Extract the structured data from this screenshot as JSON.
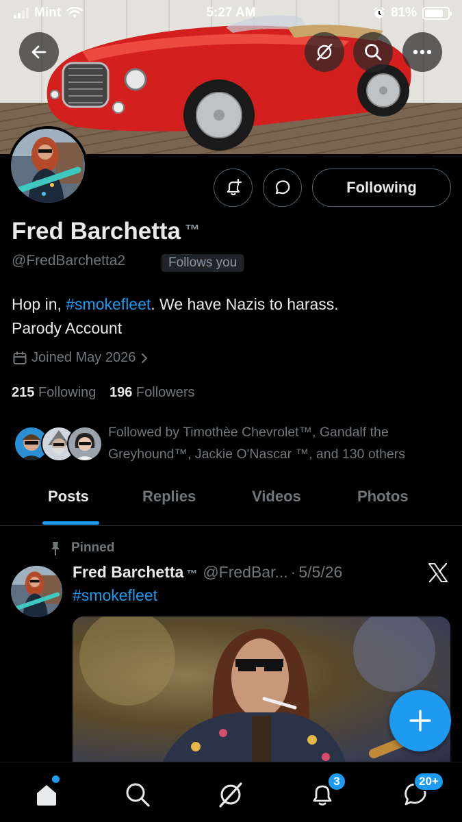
{
  "status_bar": {
    "carrier": "Mint",
    "time": "5:27 AM",
    "battery": "81%",
    "battery_level": 0.81
  },
  "header": {
    "back_icon": "arrow-left-icon",
    "grok_icon": "grok-icon",
    "search_icon": "search-icon",
    "more_icon": "more-horizontal-icon"
  },
  "profile": {
    "name": "Fred Barchetta",
    "name_suffix": "™",
    "handle": "@FredBarchetta2",
    "follows_you": "Follows you",
    "bio_prefix": "Hop in, ",
    "bio_hashtag": "#smokefleet",
    "bio_suffix": ". We have Nazis to harass.",
    "bio_line2": "Parody Account",
    "joined": "Joined May 2026",
    "following_count": "215",
    "following_label": "Following",
    "followers_count": "196",
    "followers_label": "Followers",
    "followed_by": "Followed by Timothèe Chevrolet™, Gandalf the Greyhound™, Jackie O'Nascar ™, and 130 others",
    "following_button": "Following"
  },
  "tabs": [
    "Posts",
    "Replies",
    "Videos",
    "Photos"
  ],
  "active_tab": "Posts",
  "pinned_post": {
    "pinned_label": "Pinned",
    "author": "Fred Barchetta",
    "author_suffix": "™",
    "handle_truncated": "@FredBar...",
    "separator": "·",
    "date": "5/5/26",
    "text": "#smokefleet"
  },
  "bottom_nav": {
    "items": [
      "home-icon",
      "search-icon",
      "grok-icon",
      "notifications-icon",
      "messages-icon"
    ],
    "notifications_badge": "3",
    "messages_badge": "20+"
  },
  "colors": {
    "accent": "#1d9bf0",
    "background": "#000000",
    "text_primary": "#e7e9ea",
    "text_secondary": "#71767b",
    "car": "#d41f1f"
  }
}
